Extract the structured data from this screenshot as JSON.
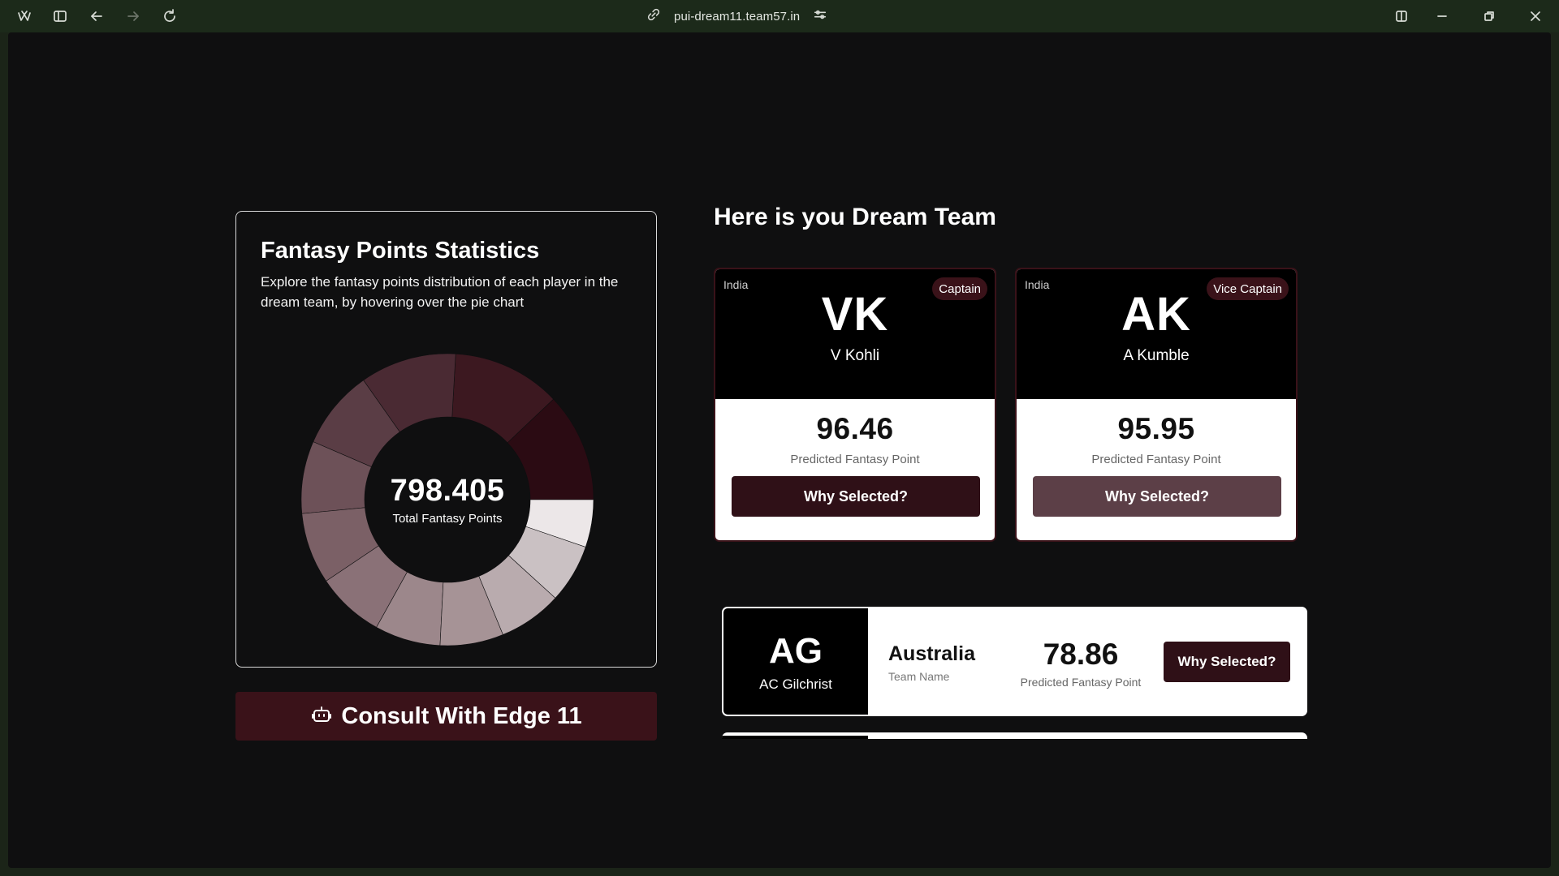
{
  "browser": {
    "url": "pui-dream11.team57.in"
  },
  "stats": {
    "title": "Fantasy Points Statistics",
    "description": "Explore the fantasy points distribution of each player in the dream team, by hovering over the pie chart",
    "total_value": "798.405",
    "total_label": "Total Fantasy Points"
  },
  "chart_data": {
    "type": "pie",
    "total": 798.405,
    "slices": [
      {
        "value": 96.46,
        "color": "#2b0b13"
      },
      {
        "value": 95.95,
        "color": "#3c1820"
      },
      {
        "value": 85.0,
        "color": "#4a2a33"
      },
      {
        "value": 70.0,
        "color": "#5a3d45"
      },
      {
        "value": 64.0,
        "color": "#6d5158"
      },
      {
        "value": 63.0,
        "color": "#7b6066"
      },
      {
        "value": 60.0,
        "color": "#8a7177"
      },
      {
        "value": 58.0,
        "color": "#9c878b"
      },
      {
        "value": 56.0,
        "color": "#a69396"
      },
      {
        "value": 56.0,
        "color": "#b9abae"
      },
      {
        "value": 52.0,
        "color": "#cac1c3"
      },
      {
        "value": 42.0,
        "color": "#ece7e8"
      }
    ]
  },
  "consult": {
    "label": "Consult With Edge 11",
    "icon": "robot-icon"
  },
  "dream_team": {
    "title": "Here is you Dream Team",
    "captains": [
      {
        "country": "India",
        "badge": "Captain",
        "initials": "VK",
        "name": "V Kohli",
        "points": "96.46",
        "points_label": "Predicted Fantasy Point",
        "button": "Why Selected?"
      },
      {
        "country": "India",
        "badge": "Vice Captain",
        "initials": "AK",
        "name": "A Kumble",
        "points": "95.95",
        "points_label": "Predicted Fantasy Point",
        "button": "Why Selected?"
      }
    ],
    "players": [
      {
        "initials": "AG",
        "name": "AC Gilchrist",
        "country": "Australia",
        "team_label": "Team Name",
        "points": "78.86",
        "points_label": "Predicted Fantasy Point",
        "button": "Why Selected?"
      }
    ]
  }
}
